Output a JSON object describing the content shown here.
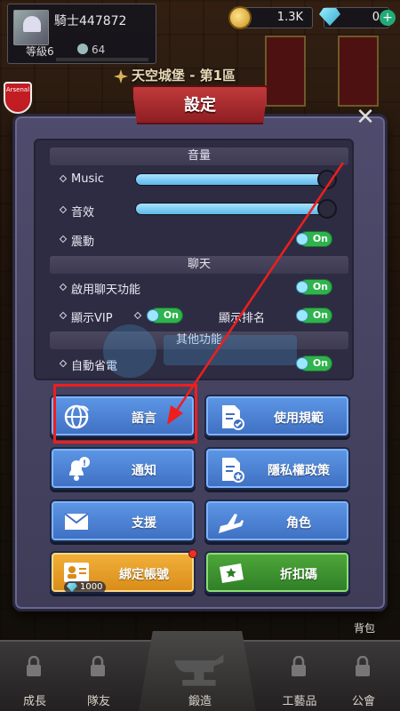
{
  "player": {
    "name": "騎士447872",
    "level": "等級6",
    "power": "64"
  },
  "currency": {
    "coins": "1.3K",
    "gems": "0"
  },
  "location": "天空城堡 - 第1區",
  "club_badge": "Arsenal",
  "dialog": {
    "title": "設定",
    "sections": {
      "volume": "音量",
      "chat": "聊天",
      "other": "其他功能"
    },
    "rows": {
      "music": {
        "label": "Music",
        "level": 1.0
      },
      "sfx": {
        "label": "音效",
        "level": 1.0
      },
      "vibration": {
        "label": "震動",
        "state": "On"
      },
      "chat_enable": {
        "label": "啟用聊天功能",
        "state": "On"
      },
      "show_vip": {
        "label": "顯示VIP",
        "state": "On"
      },
      "show_rank": {
        "label": "顯示排名",
        "state": "On"
      },
      "power_save": {
        "label": "自動省電",
        "state": "On"
      }
    },
    "buttons": {
      "language": "語言",
      "terms": "使用規範",
      "notifications": "通知",
      "privacy": "隱私權政策",
      "support": "支援",
      "character": "角色",
      "bind_account": "綁定帳號",
      "bind_reward": "1000",
      "coupon": "折扣碼"
    }
  },
  "bottom_nav": {
    "backpack": "背包",
    "items": [
      "成長",
      "隊友",
      "鍛造",
      "工藝品",
      "公會"
    ]
  },
  "colors": {
    "annotation_red": "#ef1e1e",
    "toggle_green": "#2fb34d",
    "button_blue": "#4f82d4",
    "button_orange": "#e89e28",
    "button_green": "#3f9430",
    "title_red": "#a82c2f"
  }
}
